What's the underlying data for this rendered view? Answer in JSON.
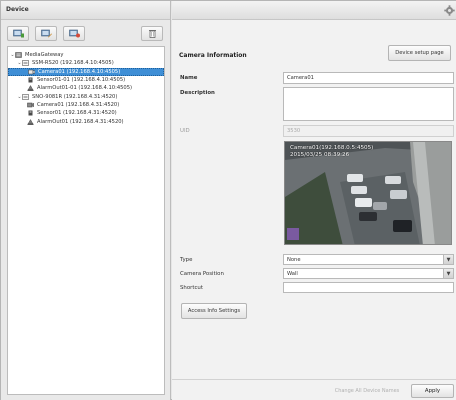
{
  "device_panel": {
    "title": "Device",
    "toolbar": [
      {
        "icon": "add-device-icon"
      },
      {
        "icon": "edit-device-icon"
      },
      {
        "icon": "group-device-icon"
      },
      {
        "icon": "delete-icon"
      }
    ],
    "tree": [
      {
        "label": "MediaGateway",
        "level": 0,
        "expanded": true,
        "icon": "gateway-icon",
        "selected": false
      },
      {
        "label": "SSM-RS20 (192.168.4.10:4505)",
        "level": 1,
        "expanded": true,
        "icon": "nvr-icon",
        "selected": false
      },
      {
        "label": "Camera01 (192.168.4.10:4505)",
        "level": 2,
        "icon": "camera-icon",
        "selected": true
      },
      {
        "label": "Sensor01-01 (192.168.4.10:4505)",
        "level": 2,
        "icon": "sensor-icon",
        "selected": false
      },
      {
        "label": "AlarmOut01-01 (192.168.4.10:4505)",
        "level": 2,
        "icon": "alarm-out-icon",
        "selected": false
      },
      {
        "label": "SNO-9081R (192.168.4.31:4520)",
        "level": 1,
        "expanded": true,
        "icon": "nvr-icon",
        "selected": false
      },
      {
        "label": "Camera01 (192.168.4.31:4520)",
        "level": 2,
        "icon": "camera-icon",
        "selected": false
      },
      {
        "label": "Sensor01 (192.168.4.31:4520)",
        "level": 2,
        "icon": "sensor-icon",
        "selected": false
      },
      {
        "label": "AlarmOut01 (192.168.4.31:4520)",
        "level": 2,
        "icon": "alarm-out-icon",
        "selected": false
      }
    ]
  },
  "info_panel": {
    "section_title": "Camera Information",
    "setup_button": "Device setup page",
    "name_label": "Name",
    "name_value": "Camera01",
    "description_label": "Description",
    "description_value": "",
    "uid_label": "UID",
    "uid_value": "3530",
    "preview_overlay_line1": "Camera01(192.168.0.5:4505)",
    "preview_overlay_line2": "2015/03/25 08:39:26",
    "type_label": "Type",
    "type_value": "None",
    "position_label": "Camera Position",
    "position_value": "Wall",
    "shortcut_label": "Shortcut",
    "shortcut_value": "",
    "access_button": "Access Info Settings",
    "change_names_button": "Change All Device Names",
    "apply_button": "Apply"
  },
  "colors": {
    "selection": "#3f8fd6",
    "panel_bg": "#f2f2f2"
  }
}
